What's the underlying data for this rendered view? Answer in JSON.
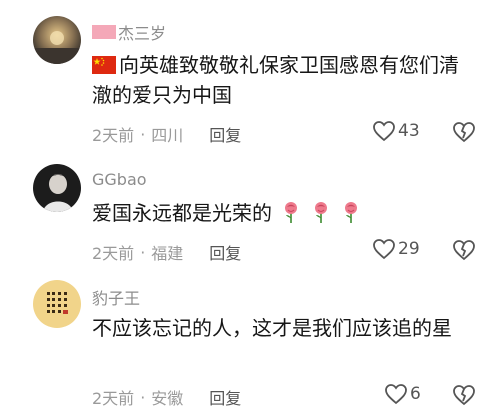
{
  "comments": [
    {
      "username": "杰三岁",
      "text": "向英雄致敬敬礼保家卫国感恩有您们清澈的爱只为中国",
      "time": "2天前",
      "location": "四川",
      "reply_label": "回复",
      "likes": "43",
      "icons": [
        "cn-flag-icon",
        "heart-icon",
        "broken-heart-icon"
      ]
    },
    {
      "username": "GGbao",
      "text": "爱国永远都是光荣的",
      "emoji": [
        "rose",
        "rose",
        "rose"
      ],
      "time": "2天前",
      "location": "福建",
      "reply_label": "回复",
      "likes": "29"
    },
    {
      "username": "豹子王",
      "text": "不应该忘记的人，这才是我们应该追的星",
      "time": "2天前",
      "location": "安徽",
      "reply_label": "回复",
      "likes": "6"
    }
  ],
  "separator": "·",
  "colors": {
    "username": "#8c8c8c",
    "text": "#161616",
    "meta": "#9a9a9a",
    "icon": "#555555",
    "flag_red": "#de2910",
    "flag_yellow": "#ffde00"
  }
}
